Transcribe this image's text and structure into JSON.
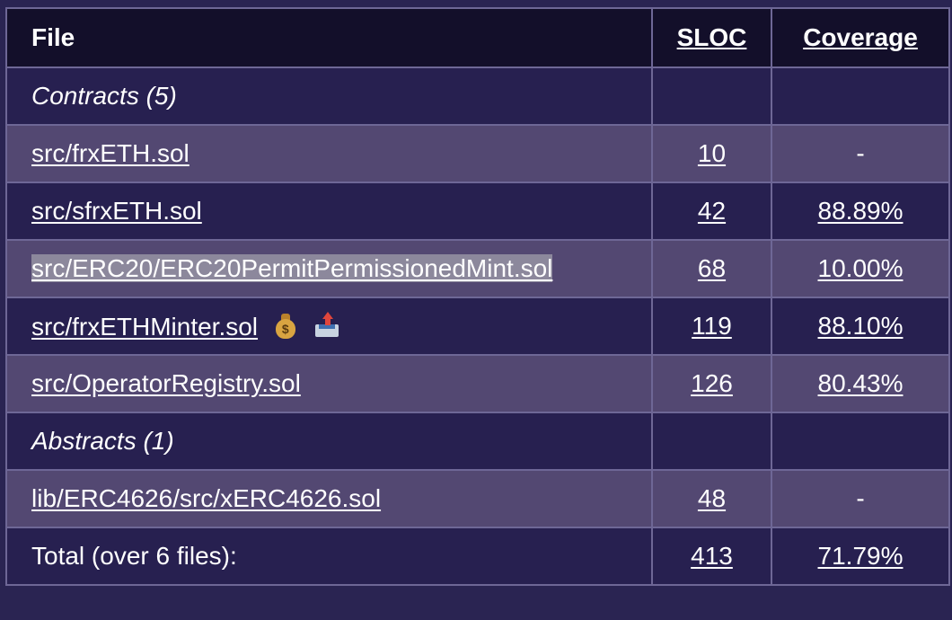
{
  "header": {
    "file": "File",
    "sloc": "SLOC",
    "coverage": "Coverage"
  },
  "groups": {
    "contracts": "Contracts (5)",
    "abstracts": "Abstracts (1)"
  },
  "rows": [
    {
      "file": "src/frxETH.sol",
      "sloc": "10",
      "coverage": "-"
    },
    {
      "file": "src/sfrxETH.sol",
      "sloc": "42",
      "coverage": "88.89%"
    },
    {
      "file": "src/ERC20/ERC20PermitPermissionedMint.sol",
      "sloc": "68",
      "coverage": "10.00%"
    },
    {
      "file": "src/frxETHMinter.sol",
      "sloc": "119",
      "coverage": "88.10%",
      "icons": [
        "money-bag-icon",
        "outbox-tray-icon"
      ]
    },
    {
      "file": "src/OperatorRegistry.sol",
      "sloc": "126",
      "coverage": "80.43%"
    },
    {
      "file": "lib/ERC4626/src/xERC4626.sol",
      "sloc": "48",
      "coverage": "-"
    }
  ],
  "total": {
    "label": "Total (over 6 files):",
    "sloc": "413",
    "coverage": "71.79%"
  },
  "colors": {
    "header_bg": "#130f2a",
    "row_dark": "#272050",
    "row_light": "#534872",
    "border": "#6e6796",
    "selection": "#8c889c"
  }
}
